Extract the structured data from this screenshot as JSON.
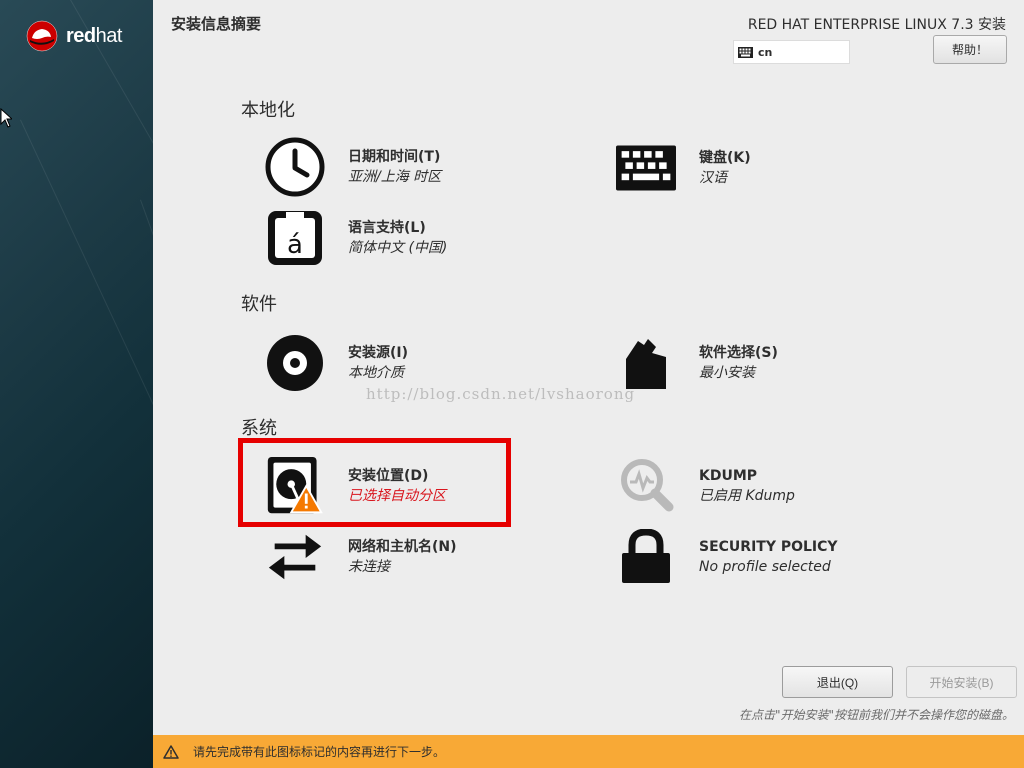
{
  "sidebar": {
    "logo_text_bold": "red",
    "logo_text_light": "hat"
  },
  "header": {
    "title": "安装信息摘要",
    "product": "RED HAT ENTERPRISE LINUX 7.3 安装",
    "keyboard_layout": "cn",
    "help_label": "帮助！"
  },
  "sections": {
    "localization": "本地化",
    "software": "软件",
    "system": "系统"
  },
  "spokes": {
    "datetime": {
      "name": "日期和时间(T)",
      "status": "亚洲/上海 时区",
      "icon": "clock-icon"
    },
    "keyboard": {
      "name": "键盘(K)",
      "status": "汉语",
      "icon": "keyboard-icon"
    },
    "language": {
      "name": "语言支持(L)",
      "status": "简体中文 (中国)",
      "icon": "language-icon"
    },
    "source": {
      "name": "安装源(I)",
      "status": "本地介质",
      "icon": "disc-icon"
    },
    "software": {
      "name": "软件选择(S)",
      "status": "最小安装",
      "icon": "package-icon"
    },
    "destination": {
      "name": "安装位置(D)",
      "status": "已选择自动分区",
      "icon": "harddisk-warning-icon"
    },
    "kdump": {
      "name": "KDUMP",
      "status": "已启用 Kdump",
      "icon": "kdump-search-icon"
    },
    "network": {
      "name": "网络和主机名(N)",
      "status": "未连接",
      "icon": "network-arrows-icon"
    },
    "security": {
      "name": "SECURITY POLICY",
      "status": "No profile selected",
      "icon": "lock-icon"
    }
  },
  "watermark": "http://blog.csdn.net/lvshaorong",
  "footer": {
    "quit_label": "退出(Q)",
    "begin_label": "开始安装(B)",
    "note": "在点击\"开始安装\"按钮前我们并不会操作您的磁盘。"
  },
  "warning_bar": {
    "text": "请先完成带有此图标标记的内容再进行下一步。"
  },
  "colors": {
    "warning": "#f8a936",
    "error_text": "#d9161e",
    "highlight": "#e60000"
  }
}
